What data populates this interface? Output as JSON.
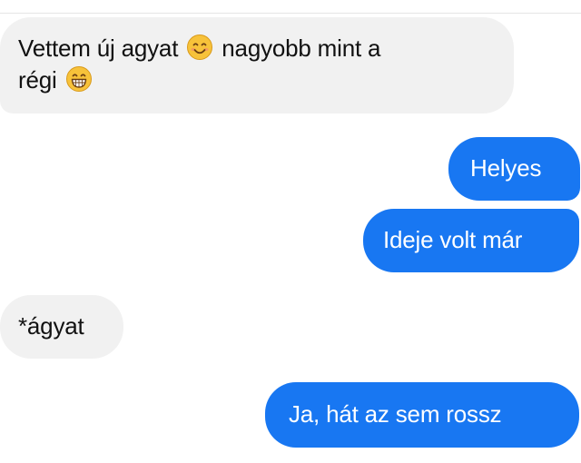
{
  "messages": [
    {
      "direction": "incoming",
      "line1": "Vettem új agyat",
      "line1_emoji": "smiling-face-icon",
      "line1_cont": "nagyobb mint a",
      "line2": "régi",
      "line2_emoji": "grinning-face-icon"
    },
    {
      "direction": "outgoing",
      "text": "Helyes"
    },
    {
      "direction": "outgoing",
      "text": "Ideje volt már"
    },
    {
      "direction": "incoming",
      "text": "*ágyat"
    },
    {
      "direction": "outgoing",
      "text": "Ja, hát az sem rossz"
    }
  ],
  "colors": {
    "incoming_bubble": "#f1f1f1",
    "incoming_text": "#111111",
    "outgoing_bubble": "#1877f2",
    "outgoing_text": "#ffffff",
    "emoji_face": "#f7c23a"
  }
}
